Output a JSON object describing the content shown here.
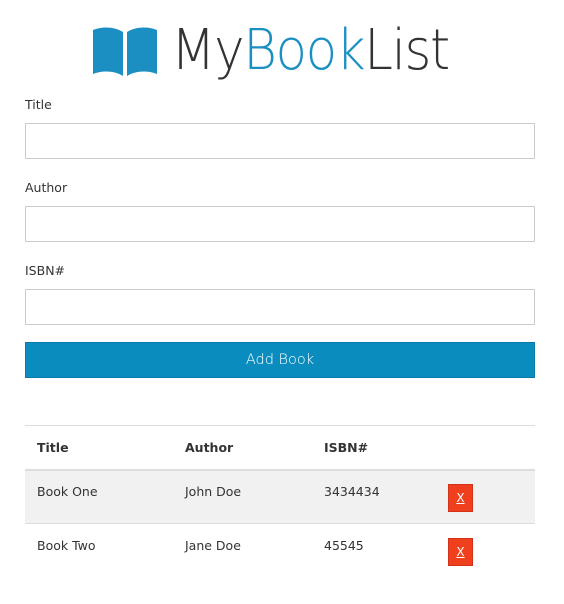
{
  "brand": {
    "name_prefix": "My",
    "name_accent": "Book",
    "name_suffix": "List",
    "icon": "open-book-icon",
    "accent_color": "#1b8fc2"
  },
  "form": {
    "title_label": "Title",
    "title_value": "",
    "author_label": "Author",
    "author_value": "",
    "isbn_label": "ISBN#",
    "isbn_value": "",
    "submit_label": "Add Book",
    "submit_color": "#0a8cbe"
  },
  "table": {
    "headers": [
      "Title",
      "Author",
      "ISBN#",
      ""
    ],
    "rows": [
      {
        "title": "Book One",
        "author": "John Doe",
        "isbn": "3434434",
        "delete_label": "X"
      },
      {
        "title": "Book Two",
        "author": "Jane Doe",
        "isbn": "45545",
        "delete_label": "X"
      }
    ],
    "delete_color": "#f03f1d"
  }
}
